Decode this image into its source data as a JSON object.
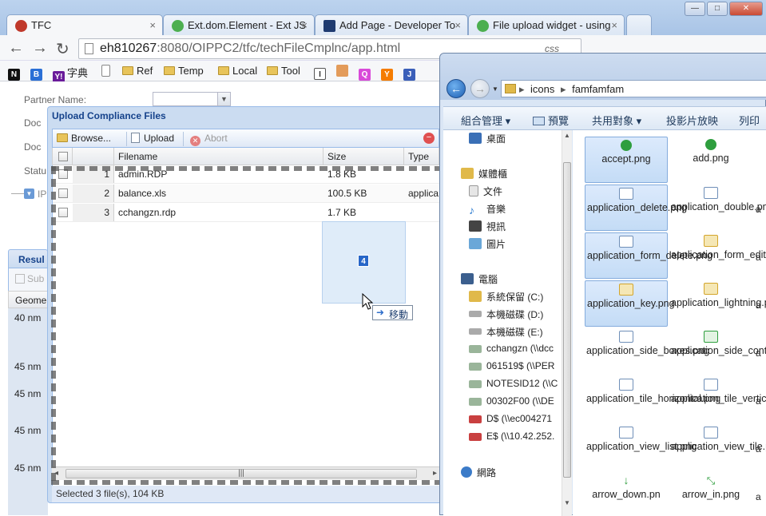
{
  "browser": {
    "tabs": [
      {
        "title": "TFC",
        "color": "#c0392b"
      },
      {
        "title": "Ext.dom.Element - Ext JS",
        "color": "#4caf50"
      },
      {
        "title": "Add Page - Developer To",
        "color": "#1f3b70"
      },
      {
        "title": "File upload widget - using",
        "color": "#4caf50"
      }
    ],
    "tab_close": "×",
    "window_buttons": {
      "minimize": "—",
      "maximize": "□",
      "close": "✕"
    },
    "url_host": "eh810267",
    "url_rest": ":8080/OIPPC2/tfc/techFileCmplnc/app.html",
    "css_badge": "css"
  },
  "bookmarks": [
    {
      "label": "",
      "icon": "N",
      "color": "#111"
    },
    {
      "label": "",
      "icon": "B",
      "color": "#2a6fd6"
    },
    {
      "label": "字典",
      "icon": "Y!",
      "color": "#6a1b9a"
    },
    {
      "label": "",
      "icon": "doc",
      "color": "#fff"
    },
    {
      "label": "Ref",
      "icon": "folder",
      "color": "#e8c45a"
    },
    {
      "label": "Temp",
      "icon": "folder",
      "color": "#e8c45a"
    },
    {
      "label": "Local",
      "icon": "folder",
      "color": "#e8c45a"
    },
    {
      "label": "Tool",
      "icon": "folder",
      "color": "#e8c45a"
    },
    {
      "label": "",
      "icon": "I",
      "color": "#888"
    },
    {
      "label": "",
      "icon": "🐹",
      "color": "#e39b5a"
    },
    {
      "label": "",
      "icon": "Q",
      "color": "#d94ad9"
    },
    {
      "label": "",
      "icon": "Y",
      "color": "#f57c00"
    },
    {
      "label": "",
      "icon": "J",
      "color": "#3b5fb9"
    }
  ],
  "form": {
    "partner_label": "Partner Name:",
    "doc_label_1": "Doc",
    "doc_label_2": "Doc",
    "status_label": "Statu",
    "ip_label": "IP",
    "result_label": "Resul",
    "submit_label": "Sub",
    "geome_label": "Geome",
    "row_values": [
      "40 nm",
      "45 nm",
      "45 nm",
      "45 nm",
      "45 nm"
    ]
  },
  "dialog": {
    "title": "Upload Compliance Files",
    "browse_label": "Browse...",
    "upload_label": "Upload",
    "abort_label": "Abort",
    "columns": [
      "Filename",
      "Size",
      "Type"
    ],
    "files": [
      {
        "index": "1",
        "filename": "admin.RDP",
        "size": "1.8 KB",
        "type": ""
      },
      {
        "index": "2",
        "filename": "balance.xls",
        "size": "100.5 KB",
        "type": "applica"
      },
      {
        "index": "3",
        "filename": "cchangzn.rdp",
        "size": "1.7 KB",
        "type": ""
      }
    ],
    "scroll_grip": "|||",
    "status": "Selected 3 file(s), 104 KB"
  },
  "drag": {
    "count": "4",
    "action": "移動"
  },
  "explorer": {
    "path": [
      "icons",
      "famfamfam"
    ],
    "commands": [
      "組合管理 ▾",
      "預覽",
      "共用對象 ▾",
      "投影片放映",
      "列印"
    ],
    "nav": [
      {
        "label": "桌面",
        "color": "#3a6fb6"
      },
      {
        "label": "媒體櫃",
        "color": "#e0b94a"
      },
      {
        "label": "文件",
        "color": "#d6d6d6"
      },
      {
        "label": "音樂",
        "color": "#2b7bd0"
      },
      {
        "label": "視訊",
        "color": "#444"
      },
      {
        "label": "圖片",
        "color": "#6aa7d8"
      },
      {
        "label": "電腦",
        "color": "#3b5f8e"
      },
      {
        "label": "系統保留 (C:)",
        "color": "#e0b94a"
      },
      {
        "label": "本機磁碟 (D:)",
        "color": "#999"
      },
      {
        "label": "本機磁碟 (E:)",
        "color": "#999"
      },
      {
        "label": "cchangzn (\\\\dcc",
        "color": "#7a9a7a"
      },
      {
        "label": "061519$ (\\\\PER",
        "color": "#7a9a7a"
      },
      {
        "label": "NOTESID12 (\\\\C",
        "color": "#7a9a7a"
      },
      {
        "label": "00302F00 (\\\\DE",
        "color": "#7a9a7a"
      },
      {
        "label": "D$ (\\\\ec004271",
        "color": "#c94040"
      },
      {
        "label": "E$ (\\\\10.42.252.",
        "color": "#c94040"
      },
      {
        "label": "網路",
        "color": "#3b7bc8"
      }
    ],
    "files": [
      {
        "name": "accept.png",
        "selected": true,
        "color": "#2e9e3e"
      },
      {
        "name": "add.png",
        "selected": false,
        "color": "#2e9e3e"
      },
      {
        "name": "application_delete.png",
        "selected": true,
        "color": "#6f8fb8"
      },
      {
        "name": "application_double.png",
        "selected": false,
        "color": "#6f8fb8"
      },
      {
        "name": "application_form_delete.png",
        "selected": true,
        "color": "#6f8fb8"
      },
      {
        "name": "application_form_edit.png",
        "selected": false,
        "color": "#d4a52c"
      },
      {
        "name": "application_key.png",
        "selected": true,
        "color": "#d4a52c"
      },
      {
        "name": "application_lightning.png",
        "selected": false,
        "color": "#d4a52c"
      },
      {
        "name": "application_side_boxes.png",
        "selected": false,
        "color": "#6f8fb8"
      },
      {
        "name": "application_side_contract.png",
        "selected": false,
        "color": "#2e9e3e"
      },
      {
        "name": "application_tile_horizontal.png",
        "selected": false,
        "color": "#6f8fb8"
      },
      {
        "name": "application_tile_vertical.png",
        "selected": false,
        "color": "#6f8fb8"
      },
      {
        "name": "application_view_list.png",
        "selected": false,
        "color": "#6f8fb8"
      },
      {
        "name": "application_view_tile.png",
        "selected": false,
        "color": "#6f8fb8"
      },
      {
        "name": "arrow_down.pn",
        "selected": false,
        "color": "#2e9e3e"
      },
      {
        "name": "arrow_in.png",
        "selected": false,
        "color": "#2e9e3e"
      }
    ],
    "peek_letters": [
      "a",
      "a",
      "a",
      "a",
      "a",
      "a",
      "a",
      "a"
    ]
  }
}
